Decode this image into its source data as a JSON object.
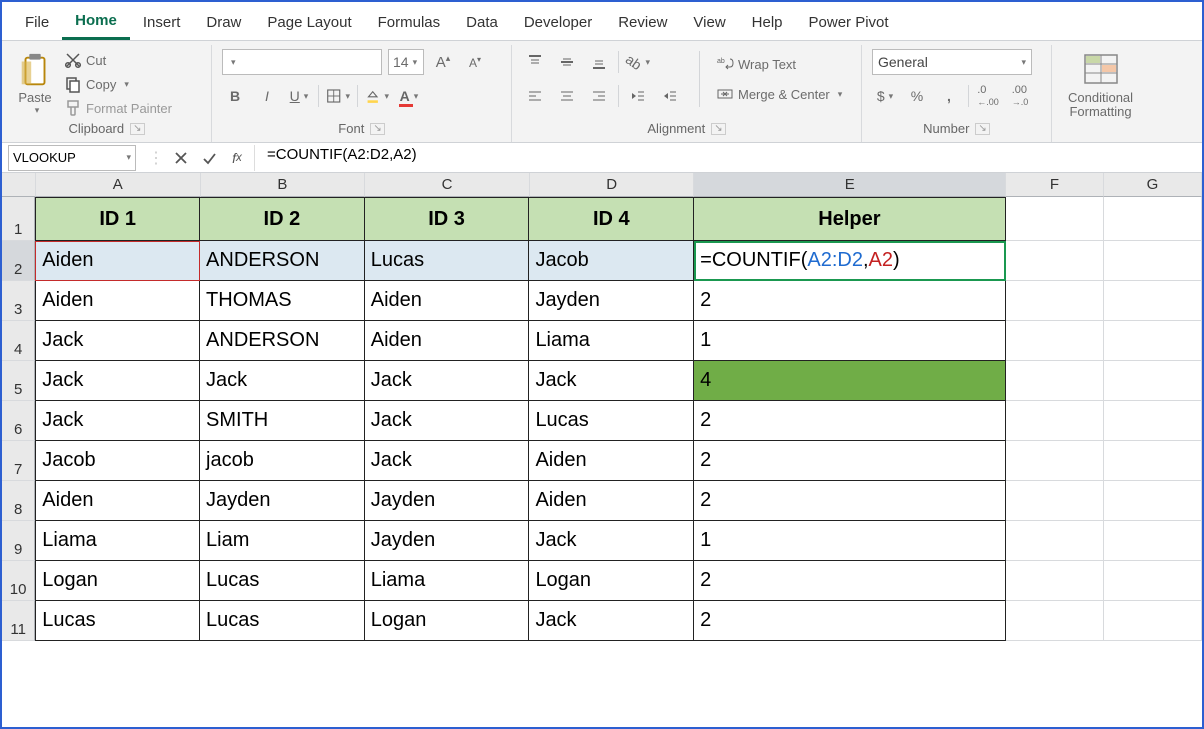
{
  "tabs": [
    "File",
    "Home",
    "Insert",
    "Draw",
    "Page Layout",
    "Formulas",
    "Data",
    "Developer",
    "Review",
    "View",
    "Help",
    "Power Pivot"
  ],
  "active_tab": "Home",
  "clipboard": {
    "paste": "Paste",
    "cut": "Cut",
    "copy": "Copy",
    "fp": "Format Painter",
    "group": "Clipboard"
  },
  "font": {
    "name": "",
    "size": "14",
    "group": "Font"
  },
  "alignment": {
    "wrap": "Wrap Text",
    "merge": "Merge & Center",
    "group": "Alignment"
  },
  "number": {
    "format": "General",
    "group": "Number"
  },
  "styles": {
    "cf": "Conditional\nFormatting"
  },
  "formula_bar": {
    "name_box": "VLOOKUP",
    "formula": "=COUNTIF(A2:D2,A2)"
  },
  "columns": [
    "A",
    "B",
    "C",
    "D",
    "E",
    "F",
    "G"
  ],
  "col_widths": [
    "wA",
    "wB",
    "wC",
    "wD",
    "wE",
    "wF",
    "wG"
  ],
  "table": {
    "headers": [
      "ID 1",
      "ID 2",
      "ID 3",
      "ID 4",
      "Helper"
    ],
    "rows": [
      {
        "a": "Aiden",
        "b": "ANDERSON",
        "c": "Lucas",
        "d": "Jacob",
        "e_formula": {
          "pre": "=COUNTIF(",
          "r1": "A2:D2",
          "sep": ",",
          "r2": "A2",
          "post": ")"
        }
      },
      {
        "a": "Aiden",
        "b": "THOMAS",
        "c": "Aiden",
        "d": "Jayden",
        "e": "2"
      },
      {
        "a": "Jack",
        "b": "ANDERSON",
        "c": "Aiden",
        "d": "Liama",
        "e": "1"
      },
      {
        "a": "Jack",
        "b": "Jack",
        "c": "Jack",
        "d": "Jack",
        "e": "4",
        "ehl": true
      },
      {
        "a": "Jack",
        "b": "SMITH",
        "c": "Jack",
        "d": "Lucas",
        "e": "2"
      },
      {
        "a": "Jacob",
        "b": "jacob",
        "c": "Jack",
        "d": "Aiden",
        "e": "2"
      },
      {
        "a": "Aiden",
        "b": "Jayden",
        "c": "Jayden",
        "d": "Aiden",
        "e": "2"
      },
      {
        "a": "Liama",
        "b": "Liam",
        "c": "Jayden",
        "d": "Jack",
        "e": "1"
      },
      {
        "a": "Logan",
        "b": "Lucas",
        "c": "Liama",
        "d": "Logan",
        "e": "2"
      },
      {
        "a": "Lucas",
        "b": "Lucas",
        "c": "Logan",
        "d": "Jack",
        "e": "2"
      }
    ]
  }
}
